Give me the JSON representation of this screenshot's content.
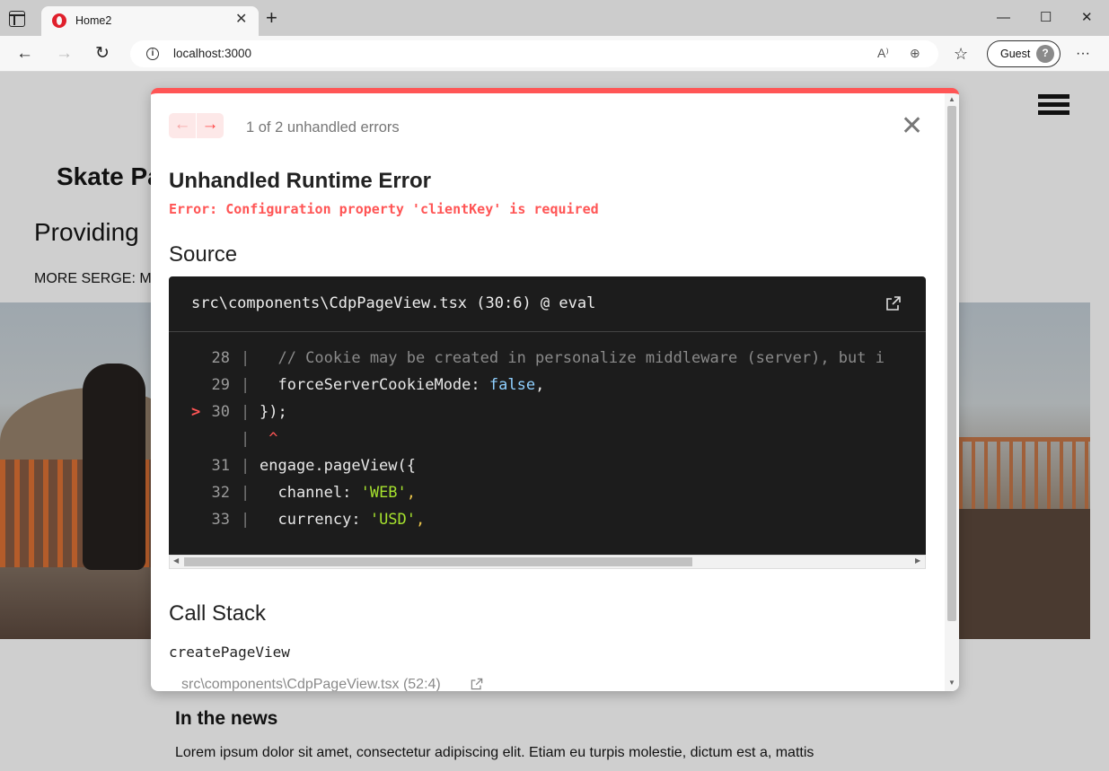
{
  "browser": {
    "tab_title": "Home2",
    "tab_close": "✕",
    "new_tab": "+",
    "minimize": "—",
    "maximize": "☐",
    "close": "✕",
    "url": "localhost:3000",
    "info": "i",
    "read_aloud": "A⁾",
    "zoom": "⊕",
    "favorites": "☆",
    "guest_label": "Guest",
    "menu": "···"
  },
  "page": {
    "brand": "Skate Pa",
    "heading": "Providing",
    "subheading": "MORE SERGE: M",
    "news_title": "In the news",
    "news_body": "Lorem ipsum dolor sit amet, consectetur adipiscing elit. Etiam eu turpis molestie, dictum est a, mattis"
  },
  "overlay": {
    "accent": "#ff5555",
    "prev_arrow": "←",
    "next_arrow": "→",
    "error_count": "1 of 2 unhandled errors",
    "close": "✕",
    "title": "Unhandled Runtime Error",
    "message": "Error: Configuration property 'clientKey' is required",
    "source_title": "Source",
    "source_file": "src\\components\\CdpPageView.tsx (30:6) @ eval",
    "code_lines": [
      {
        "marker": "",
        "num": "28",
        "gutter": "|",
        "parts": [
          [
            "c-comment",
            "  // Cookie may be created in personalize middleware (server), but i"
          ]
        ]
      },
      {
        "marker": "",
        "num": "29",
        "gutter": "|",
        "parts": [
          [
            "c-key",
            "  forceServerCookieMode: "
          ],
          [
            "c-bool",
            "false"
          ],
          [
            "c-key",
            ","
          ]
        ]
      },
      {
        "marker": ">",
        "num": "30",
        "gutter": "|",
        "parts": [
          [
            "c-key",
            "});"
          ]
        ]
      },
      {
        "marker": "",
        "num": "",
        "gutter": "|",
        "parts": [
          [
            "c-caret",
            " ^"
          ]
        ]
      },
      {
        "marker": "",
        "num": "31",
        "gutter": "|",
        "parts": [
          [
            "c-key",
            "engage.pageView({"
          ]
        ]
      },
      {
        "marker": "",
        "num": "32",
        "gutter": "|",
        "parts": [
          [
            "c-key",
            "  channel: "
          ],
          [
            "c-str",
            "'WEB'"
          ],
          [
            "c-punct",
            ","
          ]
        ]
      },
      {
        "marker": "",
        "num": "33",
        "gutter": "|",
        "parts": [
          [
            "c-key",
            "  currency: "
          ],
          [
            "c-str",
            "'USD'"
          ],
          [
            "c-punct",
            ","
          ]
        ]
      }
    ],
    "call_stack_title": "Call Stack",
    "stack_function": "createPageView",
    "stack_file": "src\\components\\CdpPageView.tsx (52:4)"
  }
}
